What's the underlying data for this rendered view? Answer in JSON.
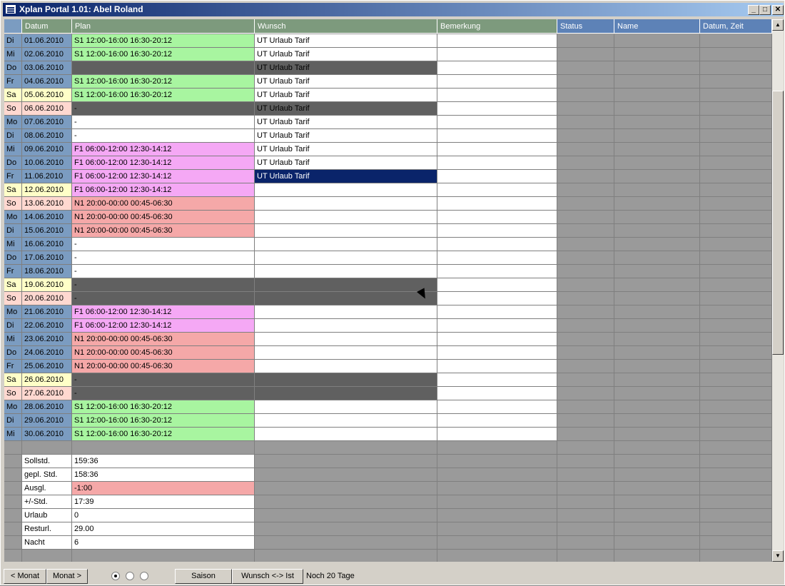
{
  "window": {
    "title": "Xplan Portal 1.01: Abel Roland"
  },
  "columns": [
    "Datum",
    "Plan",
    "Wunsch",
    "Bemerkung",
    "Status",
    "Name",
    "Datum, Zeit"
  ],
  "colors": {
    "green": "#a8f5a0",
    "pink": "#f5a8f5",
    "salmon": "#f5a8a8",
    "dark": "#606060",
    "sat": "#ffffc8",
    "sun": "#ffd8d0",
    "weekday": "#7b9cc1",
    "white": "#ffffff",
    "gray": "#9a9a9a",
    "selected": "#0a246a"
  },
  "rows": [
    {
      "day": "Di",
      "date": "01.06.2010",
      "plan": "S1 12:00-16:00 16:30-20:12",
      "planColor": "green",
      "wunsch": "UT Urlaub Tarif",
      "wunschColor": "white"
    },
    {
      "day": "Mi",
      "date": "02.06.2010",
      "plan": "S1 12:00-16:00 16:30-20:12",
      "planColor": "green",
      "wunsch": "UT Urlaub Tarif",
      "wunschColor": "white"
    },
    {
      "day": "Do",
      "date": "03.06.2010",
      "plan": "",
      "planColor": "dark",
      "wunsch": "UT Urlaub Tarif",
      "wunschColor": "dark"
    },
    {
      "day": "Fr",
      "date": "04.06.2010",
      "plan": "S1 12:00-16:00 16:30-20:12",
      "planColor": "green",
      "wunsch": "UT Urlaub Tarif",
      "wunschColor": "white"
    },
    {
      "day": "Sa",
      "date": "05.06.2010",
      "plan": "S1 12:00-16:00 16:30-20:12",
      "planColor": "green",
      "wunsch": "UT Urlaub Tarif",
      "wunschColor": "white"
    },
    {
      "day": "So",
      "date": "06.06.2010",
      "plan": "-",
      "planColor": "dark",
      "wunsch": "UT Urlaub Tarif",
      "wunschColor": "dark"
    },
    {
      "day": "Mo",
      "date": "07.06.2010",
      "plan": "-",
      "planColor": "white",
      "wunsch": "UT Urlaub Tarif",
      "wunschColor": "white"
    },
    {
      "day": "Di",
      "date": "08.06.2010",
      "plan": "-",
      "planColor": "white",
      "wunsch": "UT Urlaub Tarif",
      "wunschColor": "white"
    },
    {
      "day": "Mi",
      "date": "09.06.2010",
      "plan": "F1 06:00-12:00 12:30-14:12",
      "planColor": "pink",
      "wunsch": "UT Urlaub Tarif",
      "wunschColor": "white"
    },
    {
      "day": "Do",
      "date": "10.06.2010",
      "plan": "F1 06:00-12:00 12:30-14:12",
      "planColor": "pink",
      "wunsch": "UT Urlaub Tarif",
      "wunschColor": "white"
    },
    {
      "day": "Fr",
      "date": "11.06.2010",
      "plan": "F1 06:00-12:00 12:30-14:12",
      "planColor": "pink",
      "wunsch": "UT Urlaub Tarif",
      "wunschColor": "selected"
    },
    {
      "day": "Sa",
      "date": "12.06.2010",
      "plan": "F1 06:00-12:00 12:30-14:12",
      "planColor": "pink",
      "wunsch": "",
      "wunschColor": "white"
    },
    {
      "day": "So",
      "date": "13.06.2010",
      "plan": "N1 20:00-00:00 00:45-06:30",
      "planColor": "salmon",
      "wunsch": "",
      "wunschColor": "white"
    },
    {
      "day": "Mo",
      "date": "14.06.2010",
      "plan": "N1 20:00-00:00 00:45-06:30",
      "planColor": "salmon",
      "wunsch": "",
      "wunschColor": "white"
    },
    {
      "day": "Di",
      "date": "15.06.2010",
      "plan": "N1 20:00-00:00 00:45-06:30",
      "planColor": "salmon",
      "wunsch": "",
      "wunschColor": "white"
    },
    {
      "day": "Mi",
      "date": "16.06.2010",
      "plan": "-",
      "planColor": "white",
      "wunsch": "",
      "wunschColor": "white"
    },
    {
      "day": "Do",
      "date": "17.06.2010",
      "plan": "-",
      "planColor": "white",
      "wunsch": "",
      "wunschColor": "white"
    },
    {
      "day": "Fr",
      "date": "18.06.2010",
      "plan": "-",
      "planColor": "white",
      "wunsch": "",
      "wunschColor": "white"
    },
    {
      "day": "Sa",
      "date": "19.06.2010",
      "plan": "-",
      "planColor": "dark",
      "wunsch": "",
      "wunschColor": "dark"
    },
    {
      "day": "So",
      "date": "20.06.2010",
      "plan": "-",
      "planColor": "dark",
      "wunsch": "",
      "wunschColor": "dark"
    },
    {
      "day": "Mo",
      "date": "21.06.2010",
      "plan": "F1 06:00-12:00 12:30-14:12",
      "planColor": "pink",
      "wunsch": "",
      "wunschColor": "white"
    },
    {
      "day": "Di",
      "date": "22.06.2010",
      "plan": "F1 06:00-12:00 12:30-14:12",
      "planColor": "pink",
      "wunsch": "",
      "wunschColor": "white"
    },
    {
      "day": "Mi",
      "date": "23.06.2010",
      "plan": "N1 20:00-00:00 00:45-06:30",
      "planColor": "salmon",
      "wunsch": "",
      "wunschColor": "white"
    },
    {
      "day": "Do",
      "date": "24.06.2010",
      "plan": "N1 20:00-00:00 00:45-06:30",
      "planColor": "salmon",
      "wunsch": "",
      "wunschColor": "white"
    },
    {
      "day": "Fr",
      "date": "25.06.2010",
      "plan": "N1 20:00-00:00 00:45-06:30",
      "planColor": "salmon",
      "wunsch": "",
      "wunschColor": "white"
    },
    {
      "day": "Sa",
      "date": "26.06.2010",
      "plan": "-",
      "planColor": "dark",
      "wunsch": "",
      "wunschColor": "dark"
    },
    {
      "day": "So",
      "date": "27.06.2010",
      "plan": "-",
      "planColor": "dark",
      "wunsch": "",
      "wunschColor": "dark"
    },
    {
      "day": "Mo",
      "date": "28.06.2010",
      "plan": "S1 12:00-16:00 16:30-20:12",
      "planColor": "green",
      "wunsch": "",
      "wunschColor": "white"
    },
    {
      "day": "Di",
      "date": "29.06.2010",
      "plan": "S1 12:00-16:00 16:30-20:12",
      "planColor": "green",
      "wunsch": "",
      "wunschColor": "white"
    },
    {
      "day": "Mi",
      "date": "30.06.2010",
      "plan": "S1 12:00-16:00 16:30-20:12",
      "planColor": "green",
      "wunsch": "",
      "wunschColor": "white"
    }
  ],
  "summary": [
    {
      "label": "Sollstd.",
      "value": "159:36",
      "highlight": false
    },
    {
      "label": "gepl. Std.",
      "value": "158:36",
      "highlight": false
    },
    {
      "label": "Ausgl.",
      "value": "-1:00",
      "highlight": true
    },
    {
      "label": "+/-Std.",
      "value": "17:39",
      "highlight": false
    },
    {
      "label": "Urlaub",
      "value": "0",
      "highlight": false
    },
    {
      "label": "Resturl.",
      "value": "29.00",
      "highlight": false
    },
    {
      "label": "Nacht",
      "value": "6",
      "highlight": false
    }
  ],
  "bottom": {
    "prev_month": "< Monat",
    "next_month": "Monat >",
    "saison": "Saison",
    "wunsch_ist": "Wunsch <-> Ist",
    "status": "Noch 20 Tage"
  },
  "radios": [
    {
      "name": "radio-1",
      "checked": true
    },
    {
      "name": "radio-2",
      "checked": false
    },
    {
      "name": "radio-3",
      "checked": false
    }
  ],
  "icons": [
    "app-icon",
    "minimize-icon",
    "maximize-icon",
    "close-icon",
    "scroll-up-icon",
    "scroll-down-icon",
    "mouse-cursor-icon"
  ]
}
